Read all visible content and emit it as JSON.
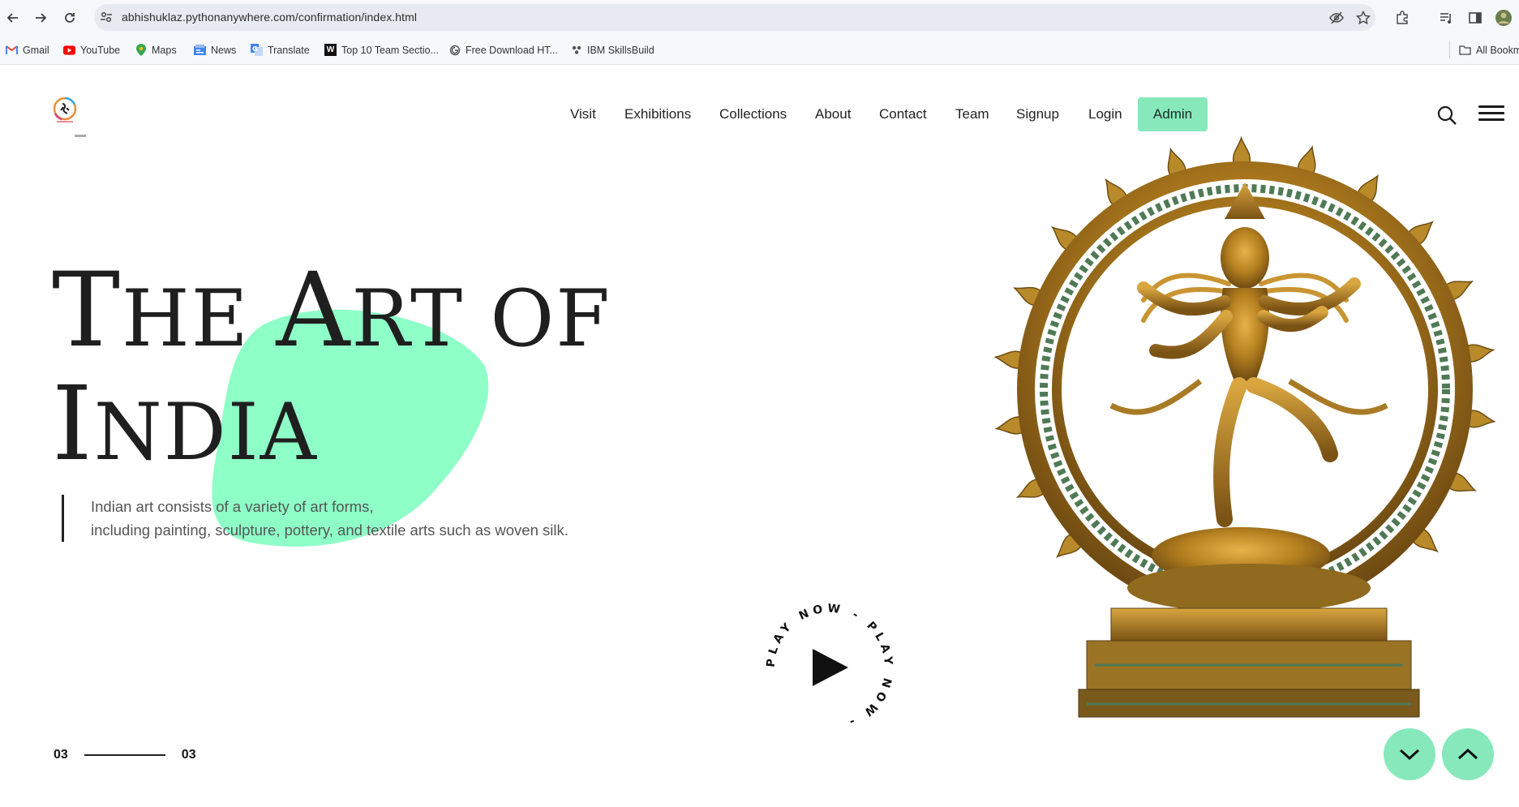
{
  "browser": {
    "url": "abhishuklaz.pythonanywhere.com/confirmation/index.html",
    "bookmarks": [
      {
        "label": "Gmail",
        "icon": "gmail-icon"
      },
      {
        "label": "YouTube",
        "icon": "youtube-icon"
      },
      {
        "label": "Maps",
        "icon": "maps-icon"
      },
      {
        "label": "News",
        "icon": "news-icon"
      },
      {
        "label": "Translate",
        "icon": "translate-icon"
      },
      {
        "label": "Top 10 Team Sectio...",
        "icon": "w-icon"
      },
      {
        "label": "Free Download HT...",
        "icon": "globe-icon"
      },
      {
        "label": "IBM SkillsBuild",
        "icon": "ibm-icon"
      }
    ],
    "all_bookmarks_label": "All Bookm"
  },
  "nav": {
    "items": [
      "Visit",
      "Exhibitions",
      "Collections",
      "About",
      "Contact",
      "Team",
      "Signup",
      "Login"
    ],
    "admin_label": "Admin"
  },
  "hero": {
    "title_line1_a": "T",
    "title_line1_b": "HE ",
    "title_line1_c": "A",
    "title_line1_d": "RT ",
    "title_line1_e": "OF",
    "title_line2_a": "I",
    "title_line2_b": "NDIA",
    "desc_line1": "Indian art consists of a variety of art forms,",
    "desc_line2": "including painting, sculpture, pottery, and textile arts such as woven silk."
  },
  "play": {
    "circular_text": "PLAY NOW - PLAY NOW - "
  },
  "slider": {
    "current": "03",
    "total": "03"
  },
  "colors": {
    "accent": "#86e8bb",
    "blob": "#8effc7"
  }
}
